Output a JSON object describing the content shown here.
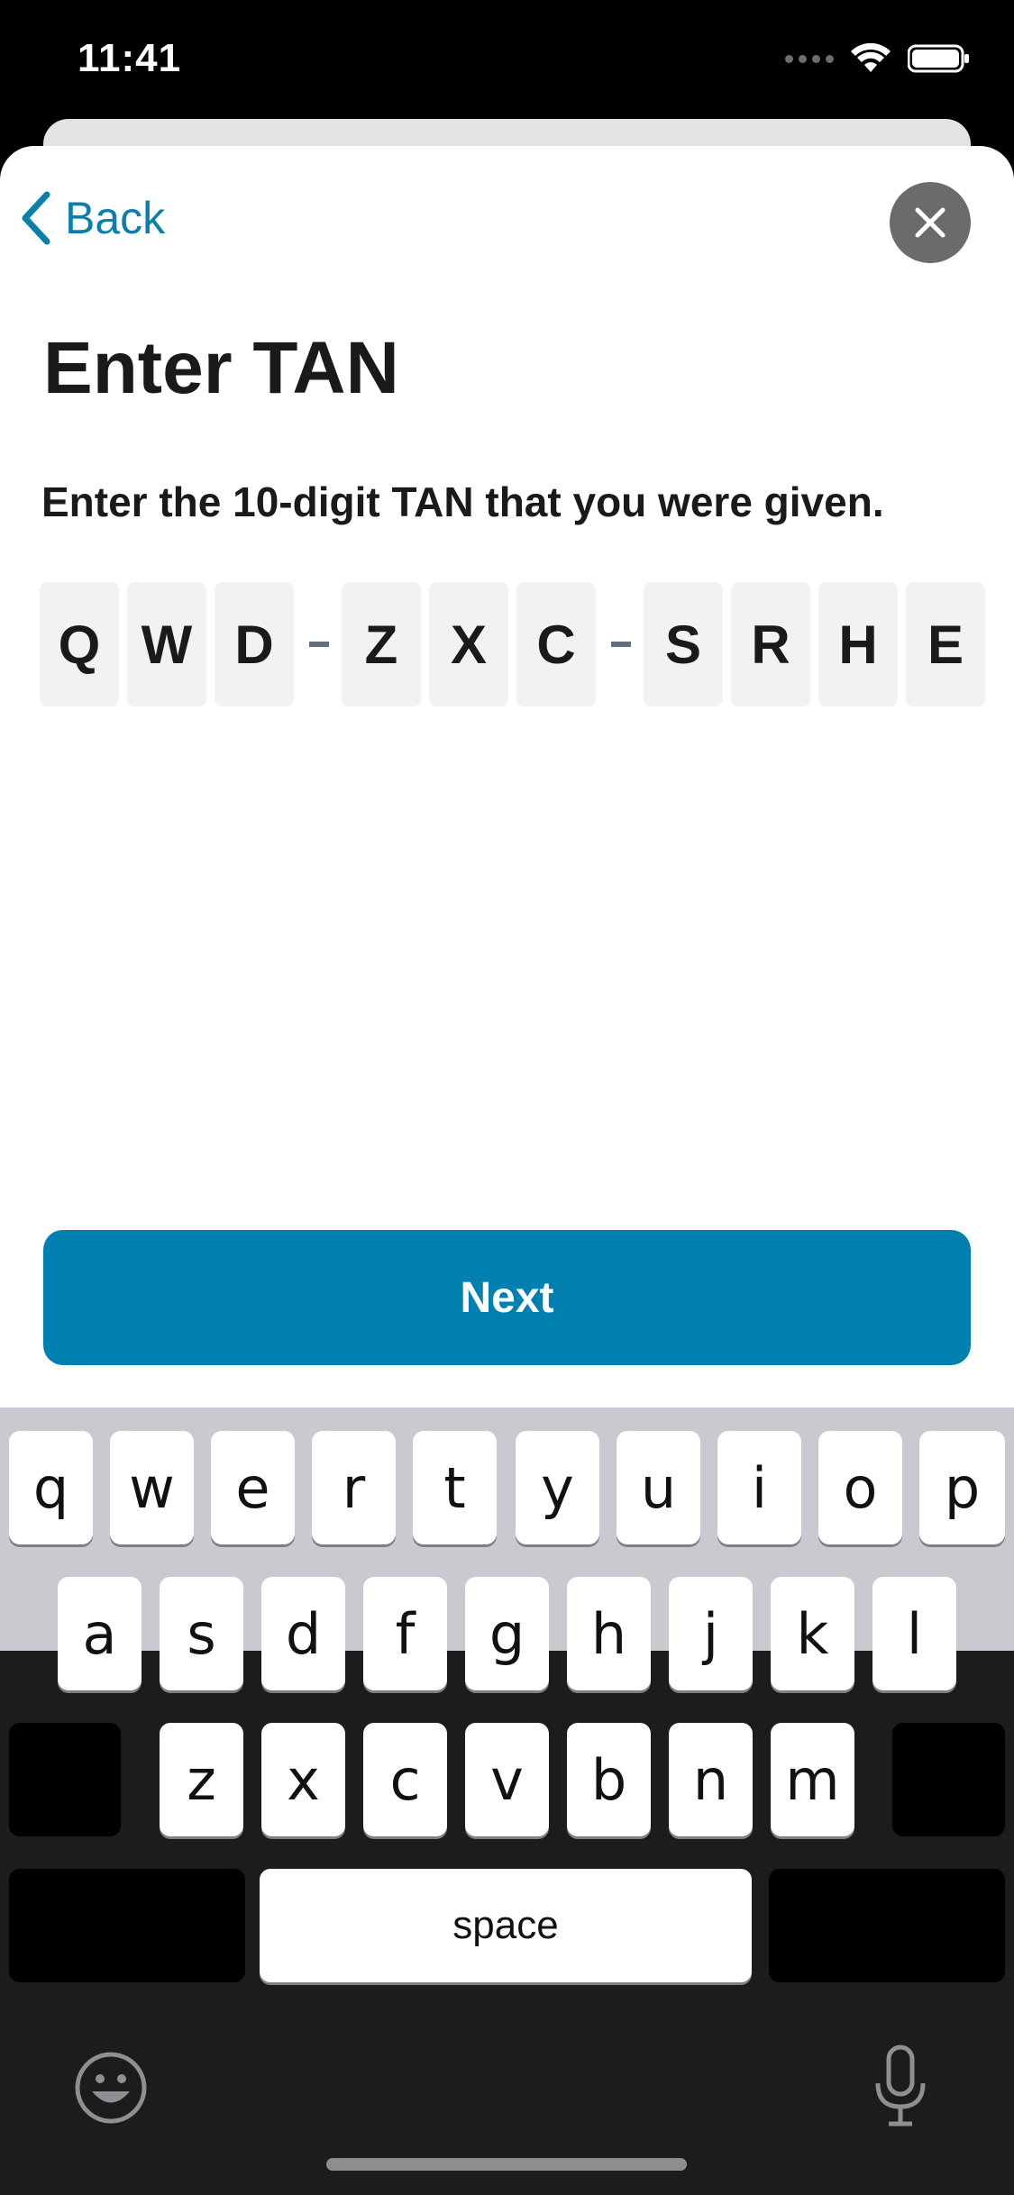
{
  "status_bar": {
    "time": "11:41"
  },
  "nav": {
    "back_label": "Back"
  },
  "page": {
    "title": "Enter TAN",
    "instructions": "Enter the 10-digit TAN that you were given."
  },
  "tan": {
    "chars": [
      "Q",
      "W",
      "D",
      "Z",
      "X",
      "C",
      "S",
      "R",
      "H",
      "E"
    ]
  },
  "actions": {
    "next_label": "Next"
  },
  "keyboard": {
    "row1": [
      "q",
      "w",
      "e",
      "r",
      "t",
      "y",
      "u",
      "i",
      "o",
      "p"
    ],
    "row2": [
      "a",
      "s",
      "d",
      "f",
      "g",
      "h",
      "j",
      "k",
      "l"
    ],
    "row3": [
      "z",
      "x",
      "c",
      "v",
      "b",
      "n",
      "m"
    ],
    "space_label": "space"
  },
  "colors": {
    "accent": "#0080b0",
    "back_text": "#0a7fac",
    "title_text": "#1a1a1a"
  }
}
